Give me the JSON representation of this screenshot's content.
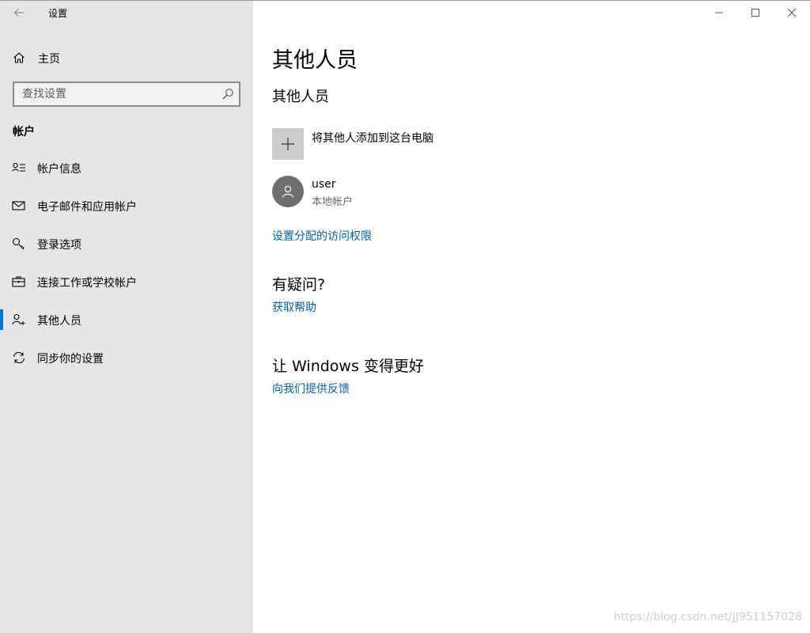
{
  "app": {
    "title": "设置"
  },
  "sidebar": {
    "home_label": "主页",
    "search_placeholder": "查找设置",
    "section_header": "帐户",
    "items": [
      {
        "label": "帐户信息",
        "icon": "account-info-icon"
      },
      {
        "label": "电子邮件和应用帐户",
        "icon": "mail-icon"
      },
      {
        "label": "登录选项",
        "icon": "key-icon"
      },
      {
        "label": "连接工作或学校帐户",
        "icon": "briefcase-icon"
      },
      {
        "label": "其他人员",
        "icon": "person-add-icon",
        "active": true
      },
      {
        "label": "同步你的设置",
        "icon": "sync-icon"
      }
    ]
  },
  "main": {
    "page_title": "其他人员",
    "sub_title": "其他人员",
    "add_label": "将其他人添加到这台电脑",
    "user": {
      "name": "user",
      "type": "本地帐户"
    },
    "assigned_access_link": "设置分配的访问权限",
    "question_heading": "有疑问?",
    "help_link": "获取帮助",
    "improve_heading": "让 Windows 变得更好",
    "feedback_link": "向我们提供反馈"
  },
  "watermark": "https://blog.csdn.net/JJ951157028",
  "colors": {
    "sidebar_bg": "#e6e6e6",
    "accent": "#0078d7",
    "link": "#0063b1"
  }
}
